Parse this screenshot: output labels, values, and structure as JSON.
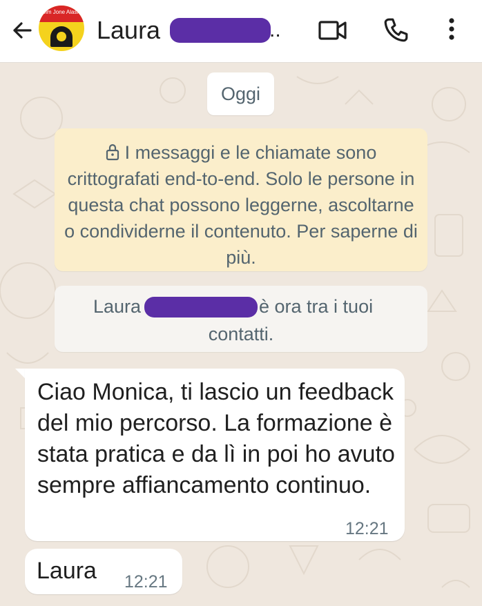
{
  "header": {
    "back_icon": "arrow-left-icon",
    "avatar": "contact-avatar",
    "avatar_text": "Jim Jone Alash",
    "contact_name": "Laura",
    "name_ellipsis": "..",
    "video_icon": "video-call-icon",
    "phone_icon": "voice-call-icon",
    "menu_icon": "more-vert-icon",
    "redaction_color": "#5b2ea6"
  },
  "chat": {
    "date_chip": "Oggi",
    "encryption_notice": "I messaggi e le chiamate sono crittografati end-to-end. Solo le persone in questa chat possono leggerne, ascoltarne o condividerne il contenuto. Per saperne di più.",
    "contact_notice": {
      "name": "Laura",
      "line1_tail": "è ora tra i tuoi",
      "line2": "contatti."
    },
    "messages": [
      {
        "text": "Ciao Monica, ti lascio un feedback del mio percorso. La formazione è stata pratica e da lì in poi ho avuto sempre affiancamento continuo.",
        "time": "12:21"
      },
      {
        "text": "Laura",
        "time": "12:21"
      }
    ]
  },
  "colors": {
    "chat_background": "#efe7de",
    "notice_background": "#fbeecb",
    "bubble_background": "#ffffff",
    "secondary_text": "#54656f"
  }
}
